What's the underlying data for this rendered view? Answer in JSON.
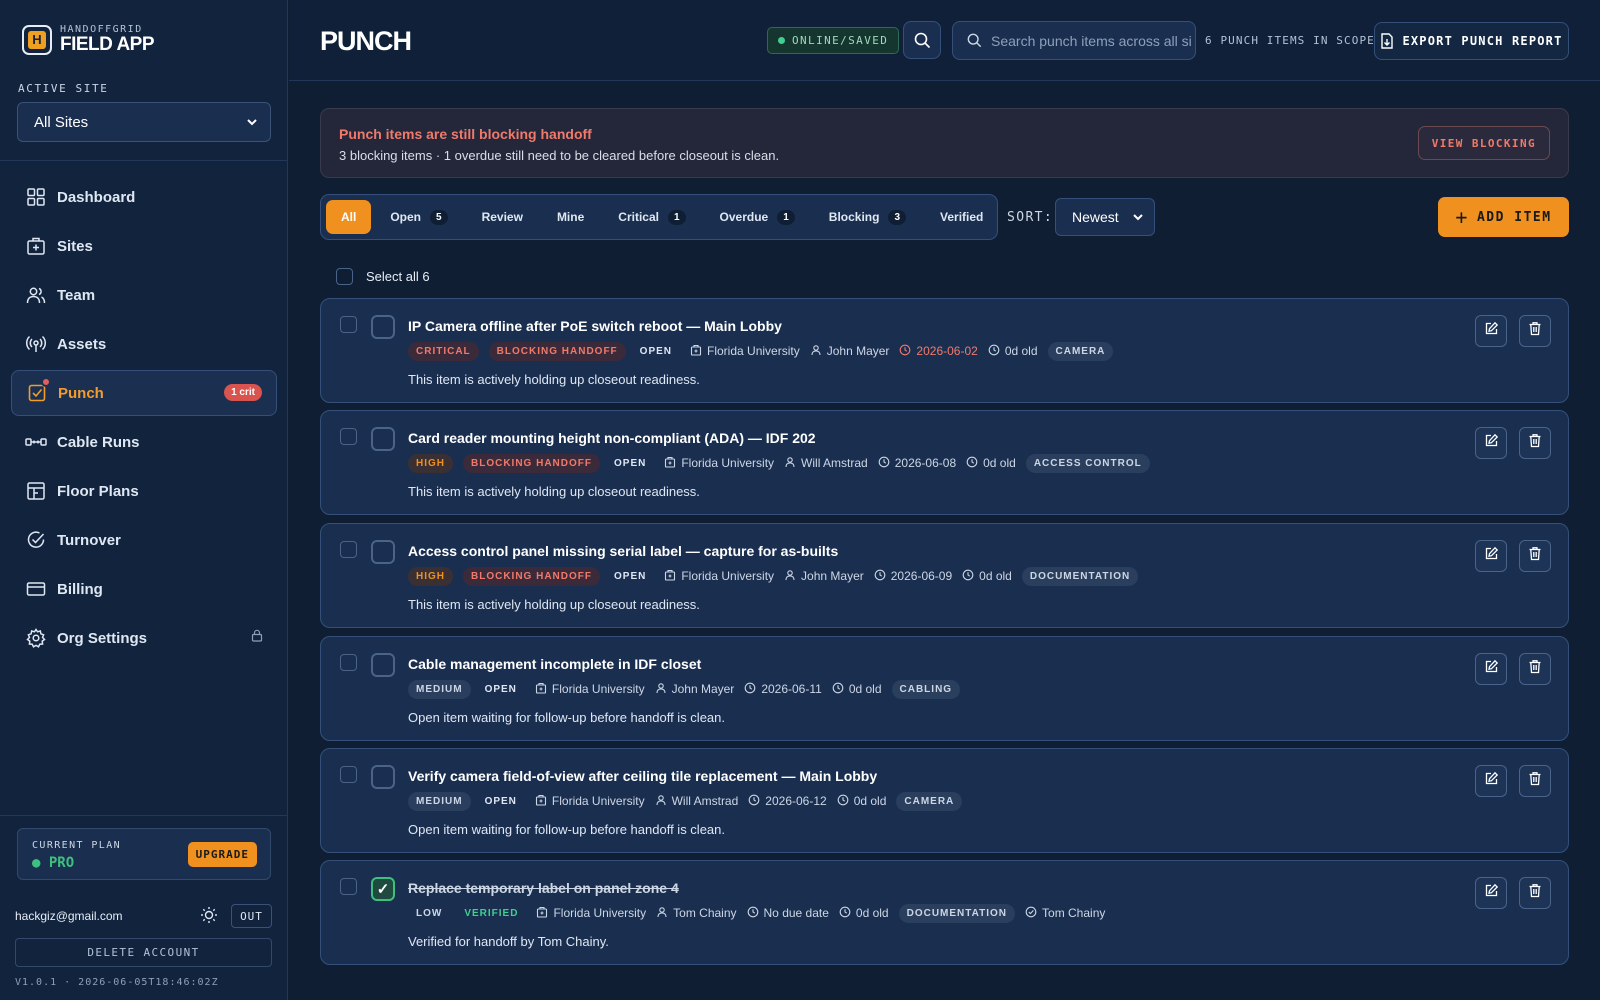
{
  "brand": {
    "sub": "HANDOFFGRID",
    "main": "FIELD APP",
    "logo_letter": "H"
  },
  "sidebar": {
    "active_site_label": "ACTIVE SITE",
    "site_value": "All Sites",
    "items": [
      {
        "label": "Dashboard",
        "icon": "grid-icon"
      },
      {
        "label": "Sites",
        "icon": "building-icon"
      },
      {
        "label": "Team",
        "icon": "users-icon"
      },
      {
        "label": "Assets",
        "icon": "signal-icon"
      },
      {
        "label": "Punch",
        "icon": "checkbox-icon",
        "badge": "1 crit",
        "active": true
      },
      {
        "label": "Cable Runs",
        "icon": "cable-icon"
      },
      {
        "label": "Floor Plans",
        "icon": "floorplan-icon"
      },
      {
        "label": "Turnover",
        "icon": "check-circle-icon"
      },
      {
        "label": "Billing",
        "icon": "card-icon"
      },
      {
        "label": "Org Settings",
        "icon": "gear-icon",
        "locked": true
      }
    ],
    "plan_label": "CURRENT PLAN",
    "plan_value": "● PRO",
    "upgrade_label": "UPGRADE",
    "email": "hackgiz@gmail.com",
    "out_label": "OUT",
    "delete_label": "DELETE ACCOUNT",
    "version": "V1.0.1 · 2026-06-05T18:46:02Z"
  },
  "topbar": {
    "title": "PUNCH",
    "status": "ONLINE/SAVED",
    "search_placeholder": "Search punch items across all sites",
    "scope": "6 PUNCH ITEMS IN SCOPE",
    "export_label": "EXPORT PUNCH REPORT"
  },
  "banner": {
    "title": "Punch items are still blocking handoff",
    "text": "3 blocking items · 1 overdue still need to be cleared before closeout is clean.",
    "button": "VIEW BLOCKING"
  },
  "filters": {
    "chips": [
      {
        "label": "All",
        "count": "",
        "active": true
      },
      {
        "label": "Open",
        "count": "5"
      },
      {
        "label": "Review",
        "count": ""
      },
      {
        "label": "Mine",
        "count": ""
      },
      {
        "label": "Critical",
        "count": "1"
      },
      {
        "label": "Overdue",
        "count": "1"
      },
      {
        "label": "Blocking",
        "count": "3"
      },
      {
        "label": "Verified",
        "count": ""
      }
    ],
    "sort_label": "SORT:",
    "sort_value": "Newest",
    "add_label": "ADD ITEM",
    "select_all": "Select all 6"
  },
  "items": [
    {
      "title": "IP Camera offline after PoE switch reboot — Main Lobby",
      "priority": "CRITICAL",
      "priority_class": "critical",
      "blocking": "BLOCKING HANDOFF",
      "status": "OPEN",
      "site": "Florida University",
      "assignee": "John Mayer",
      "due": "2026-06-02",
      "overdue": true,
      "age": "0d old",
      "category": "CAMERA",
      "desc": "This item is actively holding up closeout readiness."
    },
    {
      "title": "Card reader mounting height non-compliant (ADA) — IDF 202",
      "priority": "HIGH",
      "priority_class": "high",
      "blocking": "BLOCKING HANDOFF",
      "status": "OPEN",
      "site": "Florida University",
      "assignee": "Will Amstrad",
      "due": "2026-06-08",
      "age": "0d old",
      "category": "ACCESS CONTROL",
      "desc": "This item is actively holding up closeout readiness."
    },
    {
      "title": "Access control panel missing serial label — capture for as-builts",
      "priority": "HIGH",
      "priority_class": "high",
      "blocking": "BLOCKING HANDOFF",
      "status": "OPEN",
      "site": "Florida University",
      "assignee": "John Mayer",
      "due": "2026-06-09",
      "age": "0d old",
      "category": "DOCUMENTATION",
      "desc": "This item is actively holding up closeout readiness."
    },
    {
      "title": "Cable management incomplete in IDF closet",
      "priority": "MEDIUM",
      "priority_class": "medium",
      "blocking": "",
      "status": "OPEN",
      "site": "Florida University",
      "assignee": "John Mayer",
      "due": "2026-06-11",
      "age": "0d old",
      "category": "CABLING",
      "desc": "Open item waiting for follow-up before handoff is clean."
    },
    {
      "title": "Verify camera field-of-view after ceiling tile replacement — Main Lobby",
      "priority": "MEDIUM",
      "priority_class": "medium",
      "blocking": "",
      "status": "OPEN",
      "site": "Florida University",
      "assignee": "Will Amstrad",
      "due": "2026-06-12",
      "age": "0d old",
      "category": "CAMERA",
      "desc": "Open item waiting for follow-up before handoff is clean."
    },
    {
      "title": "Replace temporary label on panel zone 4",
      "priority": "LOW",
      "priority_class": "low",
      "blocking": "",
      "status": "VERIFIED",
      "site": "Florida University",
      "assignee": "Tom Chainy",
      "due": "No due date",
      "age": "0d old",
      "category": "DOCUMENTATION",
      "verified_by": "Tom Chainy",
      "done": true,
      "desc": "Verified for handoff by Tom Chainy."
    }
  ]
}
